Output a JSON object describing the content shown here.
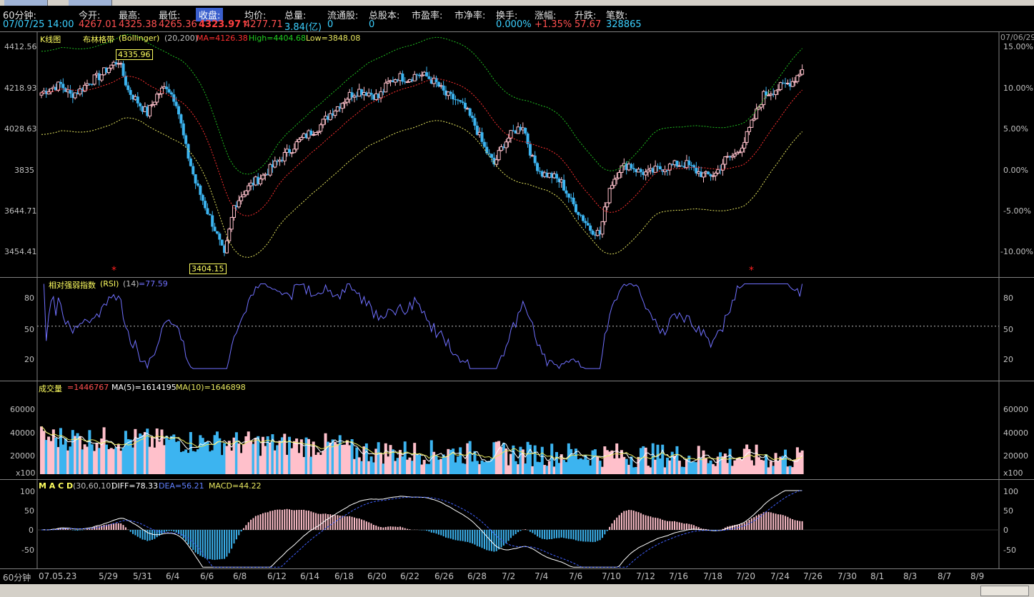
{
  "colors": {
    "up": "#ffc0cb",
    "down": "#3cb4f0",
    "bg": "#000000",
    "mid": "#ff3030",
    "upper": "#20c020",
    "lower": "#e8e860",
    "rsi": "#7070ff",
    "diff": "#ffffff",
    "dea": "#4060ff"
  },
  "header": {
    "labels": [
      "60分钟:",
      "今开:",
      "最高:",
      "最低:",
      "收盘:",
      "均价:",
      "总量:",
      "流通股:",
      "总股本:",
      "市盈率:",
      "市净率:",
      "换手:",
      "涨幅:",
      "升跌:",
      "笔数:"
    ],
    "values": [
      "07/07/25",
      "14:00",
      "4267.01",
      "4325.38",
      "4265.36",
      "4323.97↑",
      "4277.71",
      "3.84(亿)",
      "0",
      "0",
      "0.000%",
      "+1.35%",
      "57.67",
      "328865"
    ]
  },
  "kline": {
    "title": "K线图",
    "indicator": "布林格带",
    "indicator_en": "(Bollinger)",
    "params": "(20,200)",
    "ma": "MA=4126.38",
    "high": "High=4404.68",
    "low": "Low=3848.08",
    "price_axis": [
      "4412.56",
      "4218.93",
      "4028.63",
      "3835",
      "3644.71",
      "3454.41"
    ],
    "pct_axis": [
      "15.00%",
      "10.00%",
      "5.00%",
      "0.00%",
      "-5.00%",
      "-10.00%"
    ],
    "right_date": "07/06/29",
    "max_label": "4335.96",
    "min_label": "3404.15"
  },
  "rsi": {
    "title": "相对强弱指数",
    "title_en": "(RSI)",
    "params": "(14)",
    "value": "=77.59",
    "axis": [
      "80",
      "50",
      "20"
    ]
  },
  "volume": {
    "title": "成交量",
    "value": "=1446767",
    "ma5": "MA(5)=1614195",
    "ma10": "MA(10)=1646898",
    "axis": [
      "60000",
      "40000",
      "20000",
      "x100"
    ]
  },
  "macd": {
    "title": "M A C D",
    "params": "(30,60,10)",
    "diff": "DIFF=78.33",
    "dea": "DEA=56.21",
    "macd": "MACD=44.22",
    "axis": [
      "100",
      "50",
      "0",
      "-50"
    ]
  },
  "dates": {
    "corner": "60分钟",
    "labels": [
      "07.05.23",
      "5/29",
      "5/31",
      "6/4",
      "6/6",
      "6/8",
      "6/12",
      "6/14",
      "6/18",
      "6/20",
      "6/22",
      "6/26",
      "6/28",
      "7/2",
      "7/4",
      "7/6",
      "7/10",
      "7/12",
      "7/16",
      "7/18",
      "7/20",
      "7/24",
      "7/26",
      "7/30",
      "8/1",
      "8/3",
      "8/7",
      "8/9"
    ]
  },
  "chart_data": {
    "type": "candlestick",
    "close_path": [
      4190,
      4210,
      4225,
      4180,
      4200,
      4240,
      4260,
      4300,
      4330,
      4200,
      4150,
      4100,
      4180,
      4220,
      4150,
      3950,
      3800,
      3700,
      3600,
      3480,
      3700,
      3760,
      3800,
      3830,
      3870,
      3910,
      3950,
      3990,
      4020,
      4050,
      4100,
      4140,
      4180,
      4200,
      4190,
      4170,
      4230,
      4260,
      4250,
      4270,
      4260,
      4230,
      4180,
      4160,
      4120,
      4050,
      3950,
      3880,
      3970,
      4020,
      4050,
      3900,
      3840,
      3830,
      3800,
      3720,
      3660,
      3600,
      3580,
      3780,
      3860,
      3880,
      3850,
      3840,
      3860,
      3870,
      3880,
      3880,
      3850,
      3830,
      3840,
      3900,
      3920,
      3980,
      4080,
      4180,
      4200,
      4220,
      4240,
      4290
    ]
  }
}
